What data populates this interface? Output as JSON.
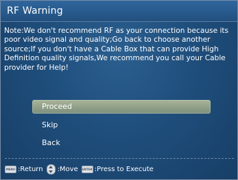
{
  "dialog": {
    "title": "RF Warning",
    "message": "Note:We don't recommend RF as your connection because its poor video signal and quality;Go back to choose another source;If you don't have a Cable Box that can provide High Definition quality signals,We recommend you call your Cable provider for Help!"
  },
  "menu": {
    "items": [
      {
        "label": "Proceed",
        "selected": true
      },
      {
        "label": "Skip",
        "selected": false
      },
      {
        "label": "Back",
        "selected": false
      }
    ]
  },
  "footer": {
    "return_icon": "menu-key-icon",
    "return_label": ":Return",
    "move_icon": "up-down-key-icon",
    "move_label": ":Move",
    "execute_icon": "enter-key-icon",
    "execute_label": ":Press to Execute"
  },
  "colors": {
    "background": "#1f4e7c",
    "selected_item": "#9aa68e",
    "text": "#ffffff"
  }
}
